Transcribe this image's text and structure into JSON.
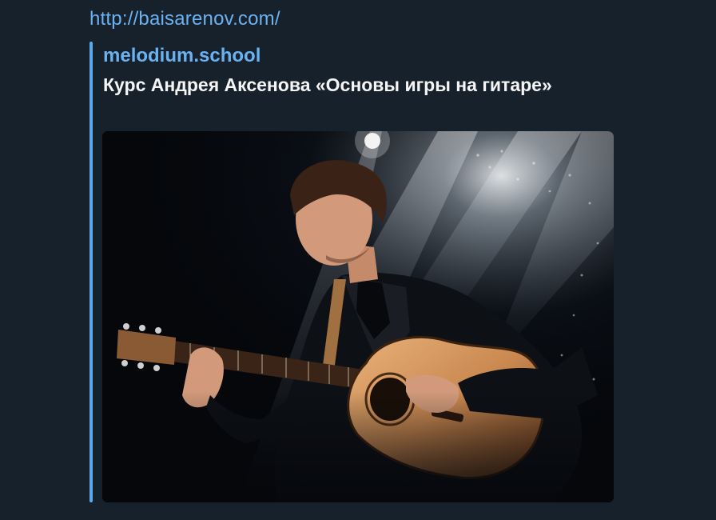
{
  "message": {
    "link_text": "http://baisarenov.com/"
  },
  "link_preview": {
    "site_name": "melodium.school",
    "title": "Курс Андрея Аксенова «Основы игры на гитаре»",
    "image_icon": "guitarist-photo"
  },
  "colors": {
    "background": "#17212b",
    "link": "#6ab2f2",
    "accent_bar": "#5aa7ea",
    "title_text": "#f5f5f5"
  }
}
